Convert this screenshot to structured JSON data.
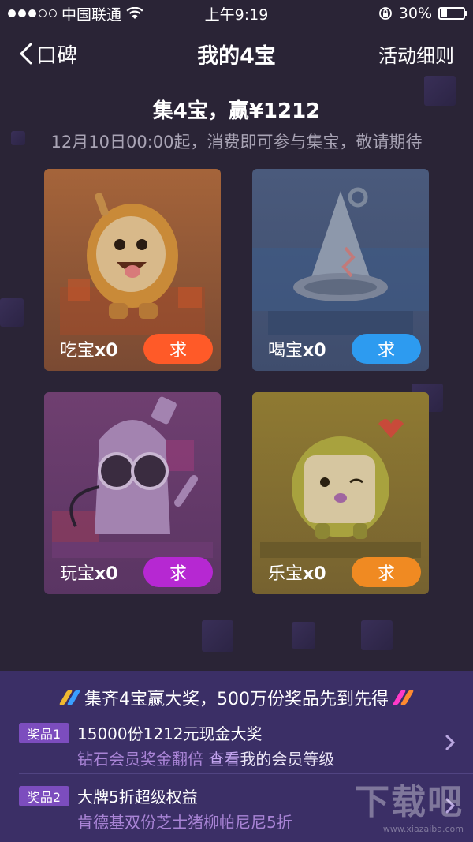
{
  "status_bar": {
    "carrier": "中国联通",
    "time": "上午9:19",
    "battery_text": "30%",
    "battery_level": 0.3
  },
  "nav": {
    "back_label": "口碑",
    "title": "我的4宝",
    "rules_label": "活动细则"
  },
  "header": {
    "headline": "集4宝，赢¥1212",
    "subline": "12月10日00:00起，消费即可参与集宝，敬请期待"
  },
  "cards": [
    {
      "name": "吃宝",
      "count": "x0",
      "button": "求",
      "button_color": "#ff5a28",
      "bg_top": "#a5643a",
      "bg_bottom": "#7a4a33"
    },
    {
      "name": "喝宝",
      "count": "x0",
      "button": "求",
      "button_color": "#2d9bf0",
      "bg_top": "#4a5a7c",
      "bg_bottom": "#3f4d6d"
    },
    {
      "name": "玩宝",
      "count": "x0",
      "button": "求",
      "button_color": "#b628d2",
      "bg_top": "#6f3f70",
      "bg_bottom": "#5a3563"
    },
    {
      "name": "乐宝",
      "count": "x0",
      "button": "求",
      "button_color": "#f08a22",
      "bg_top": "#8f7a32",
      "bg_bottom": "#766230"
    }
  ],
  "promo": {
    "title": "集齐4宝赢大奖，500万份奖品先到先得",
    "prizes": [
      {
        "tag": "奖品1",
        "main": "15000份1212元现金大奖",
        "sub_prefix": "钻石会员奖金翻倍 ",
        "sub_link": "查看",
        "sub_suffix": "我的会员等级"
      },
      {
        "tag": "奖品2",
        "main": "大牌5折超级权益",
        "sub_prefix": "肯德基双份芝士猪柳帕尼尼5折",
        "sub_link": "",
        "sub_suffix": ""
      }
    ]
  },
  "watermark": {
    "main": "下载吧",
    "sub": "www.xiazaiba.com"
  },
  "colors": {
    "background": "#2a2436",
    "panel": "#3b2f66",
    "tag": "#7c4dbe"
  }
}
